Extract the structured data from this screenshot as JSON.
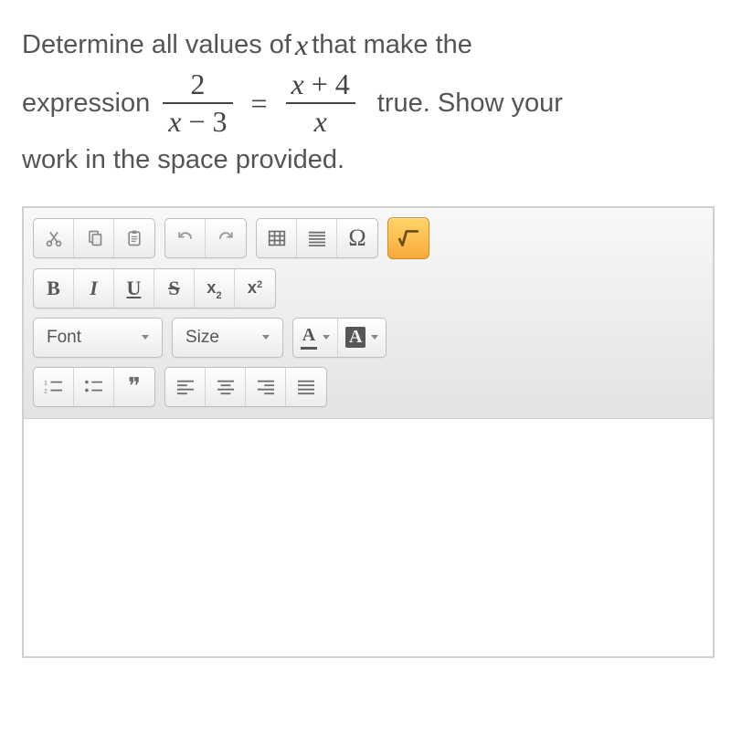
{
  "question": {
    "line1_pre": "Determine all values of ",
    "var": "x",
    "line1_post": " that make the",
    "line2_pre": "expression",
    "frac1_top": "2",
    "frac1_bot_left": "x",
    "frac1_bot_op": " − ",
    "frac1_bot_right": "3",
    "equals": "=",
    "frac2_top_left": "x",
    "frac2_top_op": " + ",
    "frac2_top_right": "4",
    "frac2_bot": "x",
    "line2_post": "true. Show your",
    "line3": "work in the space provided."
  },
  "toolbar": {
    "cut": "cut-icon",
    "copy": "copy-icon",
    "paste": "paste-icon",
    "undo": "undo-icon",
    "redo": "redo-icon",
    "table": "table-icon",
    "linespacing": "line-spacing-icon",
    "omega": "Ω",
    "math": "√",
    "bold": "B",
    "italic": "I",
    "underline": "U",
    "strike": "S",
    "sub_base": "x",
    "sub_small": "2",
    "sup_base": "x",
    "sup_small": "2",
    "font_label": "Font",
    "size_label": "Size",
    "textcolor": "A",
    "bgcolor": "A",
    "numlist": "numbered-list-icon",
    "bulllist": "bullet-list-icon",
    "quote": "❞",
    "align_left": "align-left-icon",
    "align_center": "align-center-icon",
    "align_right": "align-right-icon",
    "align_justify": "align-justify-icon"
  }
}
